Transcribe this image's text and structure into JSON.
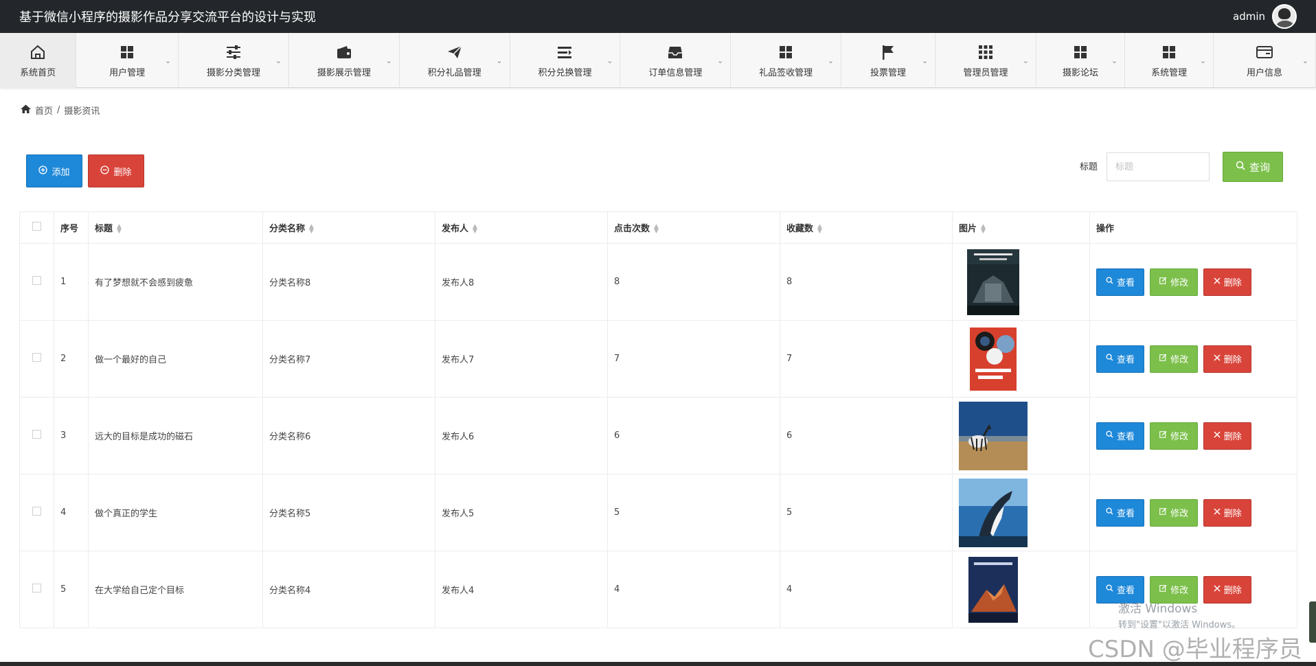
{
  "header": {
    "title": "基于微信小程序的摄影作品分享交流平台的设计与实现",
    "username": "admin"
  },
  "nav": [
    {
      "label": "系统首页",
      "icon": "home-icon"
    },
    {
      "label": "用户管理",
      "icon": "grid-icon"
    },
    {
      "label": "摄影分类管理",
      "icon": "sliders-icon"
    },
    {
      "label": "摄影展示管理",
      "icon": "wallet-icon"
    },
    {
      "label": "积分礼品管理",
      "icon": "paper-plane-icon"
    },
    {
      "label": "积分兑换管理",
      "icon": "list-icon"
    },
    {
      "label": "订单信息管理",
      "icon": "inbox-icon"
    },
    {
      "label": "礼品签收管理",
      "icon": "grid-icon"
    },
    {
      "label": "投票管理",
      "icon": "flag-icon"
    },
    {
      "label": "管理员管理",
      "icon": "apps-icon"
    },
    {
      "label": "摄影论坛",
      "icon": "grid-icon"
    },
    {
      "label": "系统管理",
      "icon": "grid-icon"
    },
    {
      "label": "用户信息",
      "icon": "card-icon"
    }
  ],
  "breadcrumb": {
    "home": "首页",
    "separator": "/",
    "current": "摄影资讯"
  },
  "toolbar": {
    "add_label": "添加",
    "delete_label": "删除"
  },
  "search": {
    "label": "标题",
    "placeholder": "标题",
    "value": "",
    "button_label": "查询"
  },
  "table": {
    "columns": [
      "序号",
      "标题",
      "分类名称",
      "发布人",
      "点击次数",
      "收藏数",
      "图片",
      "操作"
    ],
    "rows": [
      {
        "no": "1",
        "title": "有了梦想就不会感到疲惫",
        "category": "分类名称8",
        "publisher": "发布人8",
        "clicks": "8",
        "favorites": "8",
        "image": "cover-book-city-architecture"
      },
      {
        "no": "2",
        "title": "做一个最好的自己",
        "category": "分类名称7",
        "publisher": "发布人7",
        "clicks": "7",
        "favorites": "7",
        "image": "cover-book-pro-photographer"
      },
      {
        "no": "3",
        "title": "远大的目标是成功的磁石",
        "category": "分类名称6",
        "publisher": "发布人6",
        "clicks": "6",
        "favorites": "6",
        "image": "photo-zebra-savanna"
      },
      {
        "no": "4",
        "title": "做个真正的学生",
        "category": "分类名称5",
        "publisher": "发布人5",
        "clicks": "5",
        "favorites": "5",
        "image": "photo-whale-breaching"
      },
      {
        "no": "5",
        "title": "在大学给自己定个目标",
        "category": "分类名称4",
        "publisher": "发布人4",
        "clicks": "4",
        "favorites": "4",
        "image": "cover-book-mountain"
      }
    ],
    "actions": {
      "view": "查看",
      "edit": "修改",
      "delete": "删除"
    }
  },
  "overlay": {
    "activate_line1": "激活 Windows",
    "activate_line2": "转到\"设置\"以激活 Windows。",
    "watermark": "CSDN @毕业程序员"
  },
  "colors": {
    "topbar": "#23272b",
    "primary": "#1e88d9",
    "success": "#7cc04b",
    "danger": "#d9443a"
  }
}
